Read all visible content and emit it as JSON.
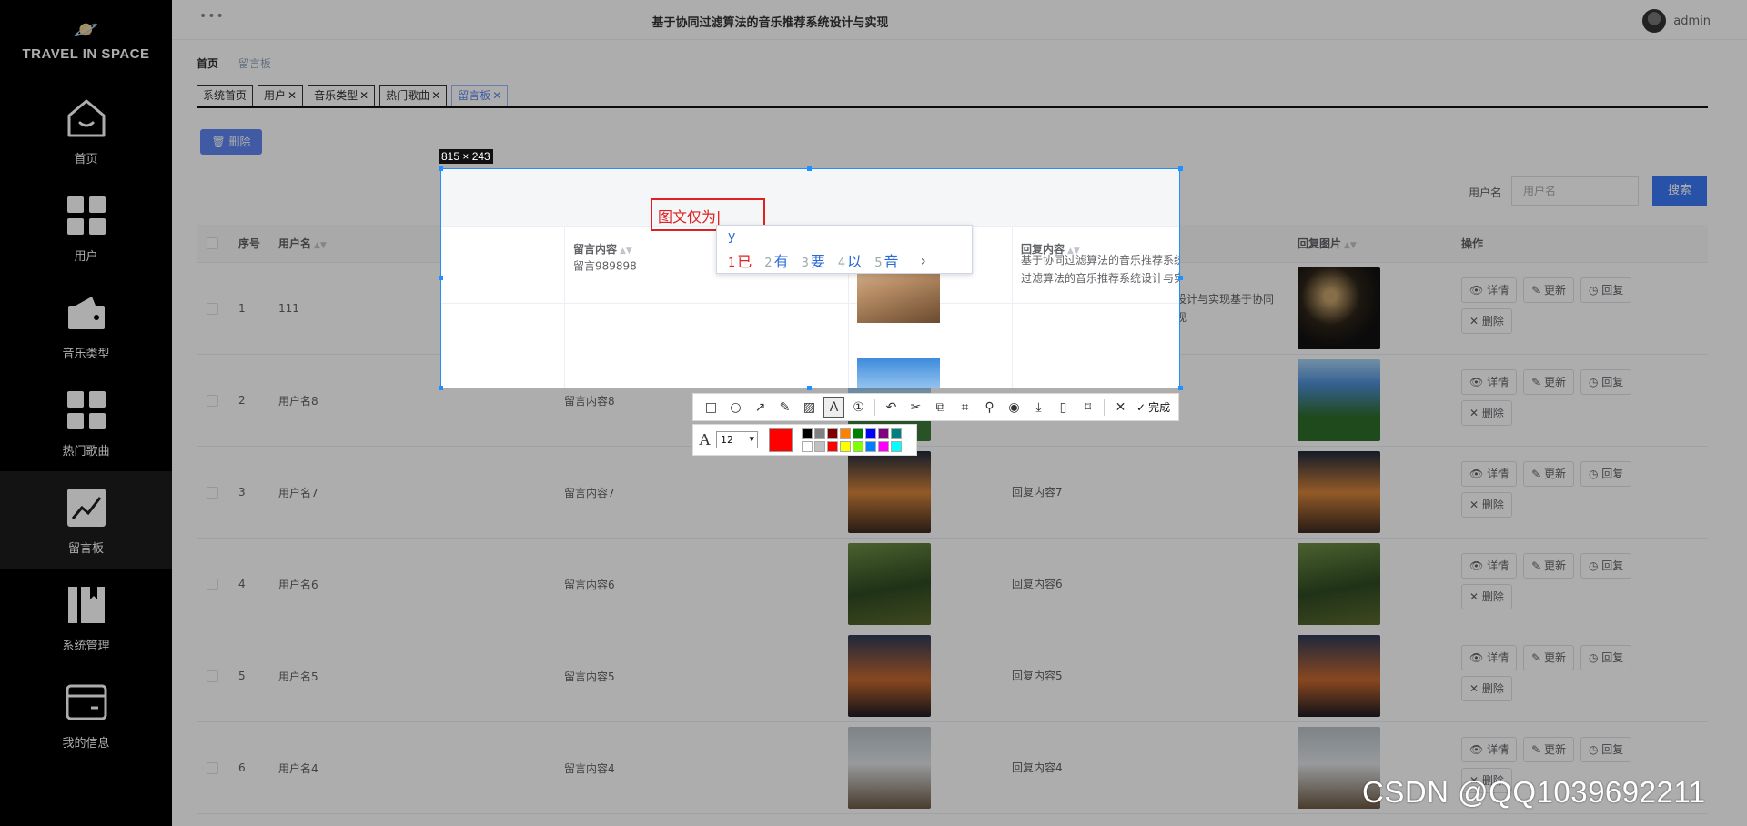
{
  "header": {
    "title": "基于协同过滤算法的音乐推荐系统设计与实现",
    "user": "admin"
  },
  "logo": {
    "title": "TRAVEL IN SPACE"
  },
  "sidebar": {
    "items": [
      {
        "label": "首页",
        "icon": "home-icon"
      },
      {
        "label": "用户",
        "icon": "grid-icon"
      },
      {
        "label": "音乐类型",
        "icon": "wallet-icon"
      },
      {
        "label": "热门歌曲",
        "icon": "grid-icon"
      },
      {
        "label": "留言板",
        "icon": "chart-icon"
      },
      {
        "label": "系统管理",
        "icon": "book-icon"
      },
      {
        "label": "我的信息",
        "icon": "card-icon"
      }
    ]
  },
  "breadcrumb": {
    "home": "首页",
    "current": "留言板"
  },
  "tabs": [
    {
      "label": "系统首页"
    },
    {
      "label": "用户"
    },
    {
      "label": "音乐类型"
    },
    {
      "label": "热门歌曲"
    },
    {
      "label": "留言板"
    }
  ],
  "toolbar": {
    "delete_label": "删除"
  },
  "search": {
    "label": "用户名",
    "placeholder": "用户名",
    "button": "搜索"
  },
  "table": {
    "headers": {
      "index": "序号",
      "username": "用户名",
      "message": "留言内容",
      "reply": "回复内容",
      "reply_image": "回复图片",
      "ops": "操作"
    },
    "op_labels": {
      "detail": "详情",
      "update": "更新",
      "reply": "回复",
      "delete": "删除"
    },
    "rows": [
      {
        "index": "1",
        "username": "111",
        "message": "留言989898",
        "reply": "基于协同过滤算法的音乐推荐系统设计与实现基于协同过滤算法的音乐推荐系统设计与实现"
      },
      {
        "index": "2",
        "username": "用户名8",
        "message": "留言内容8",
        "reply": ""
      },
      {
        "index": "3",
        "username": "用户名7",
        "message": "留言内容7",
        "reply": "回复内容7"
      },
      {
        "index": "4",
        "username": "用户名6",
        "message": "留言内容6",
        "reply": "回复内容6"
      },
      {
        "index": "5",
        "username": "用户名5",
        "message": "留言内容5",
        "reply": "回复内容5"
      },
      {
        "index": "6",
        "username": "用户名4",
        "message": "留言内容4",
        "reply": "回复内容4"
      }
    ]
  },
  "capture": {
    "size_label": "815 × 243",
    "text_input": "图文仅为",
    "ime": {
      "composition": "y",
      "candidates": [
        "已",
        "有",
        "要",
        "以",
        "音"
      ],
      "numbers": [
        "1",
        "2",
        "3",
        "4",
        "5"
      ]
    },
    "tools": {
      "finish": "完成"
    },
    "font_size": "12",
    "current_color": "#ff0000",
    "palette": [
      "#000000",
      "#808080",
      "#800000",
      "#ff8000",
      "#008000",
      "#0000ff",
      "#800080",
      "#008080",
      "#ffffff",
      "#c0c0c0",
      "#ff0000",
      "#ffff00",
      "#80ff00",
      "#0080ff",
      "#ff00ff",
      "#00ffff"
    ]
  },
  "watermark": "CSDN @QQ1039692211"
}
